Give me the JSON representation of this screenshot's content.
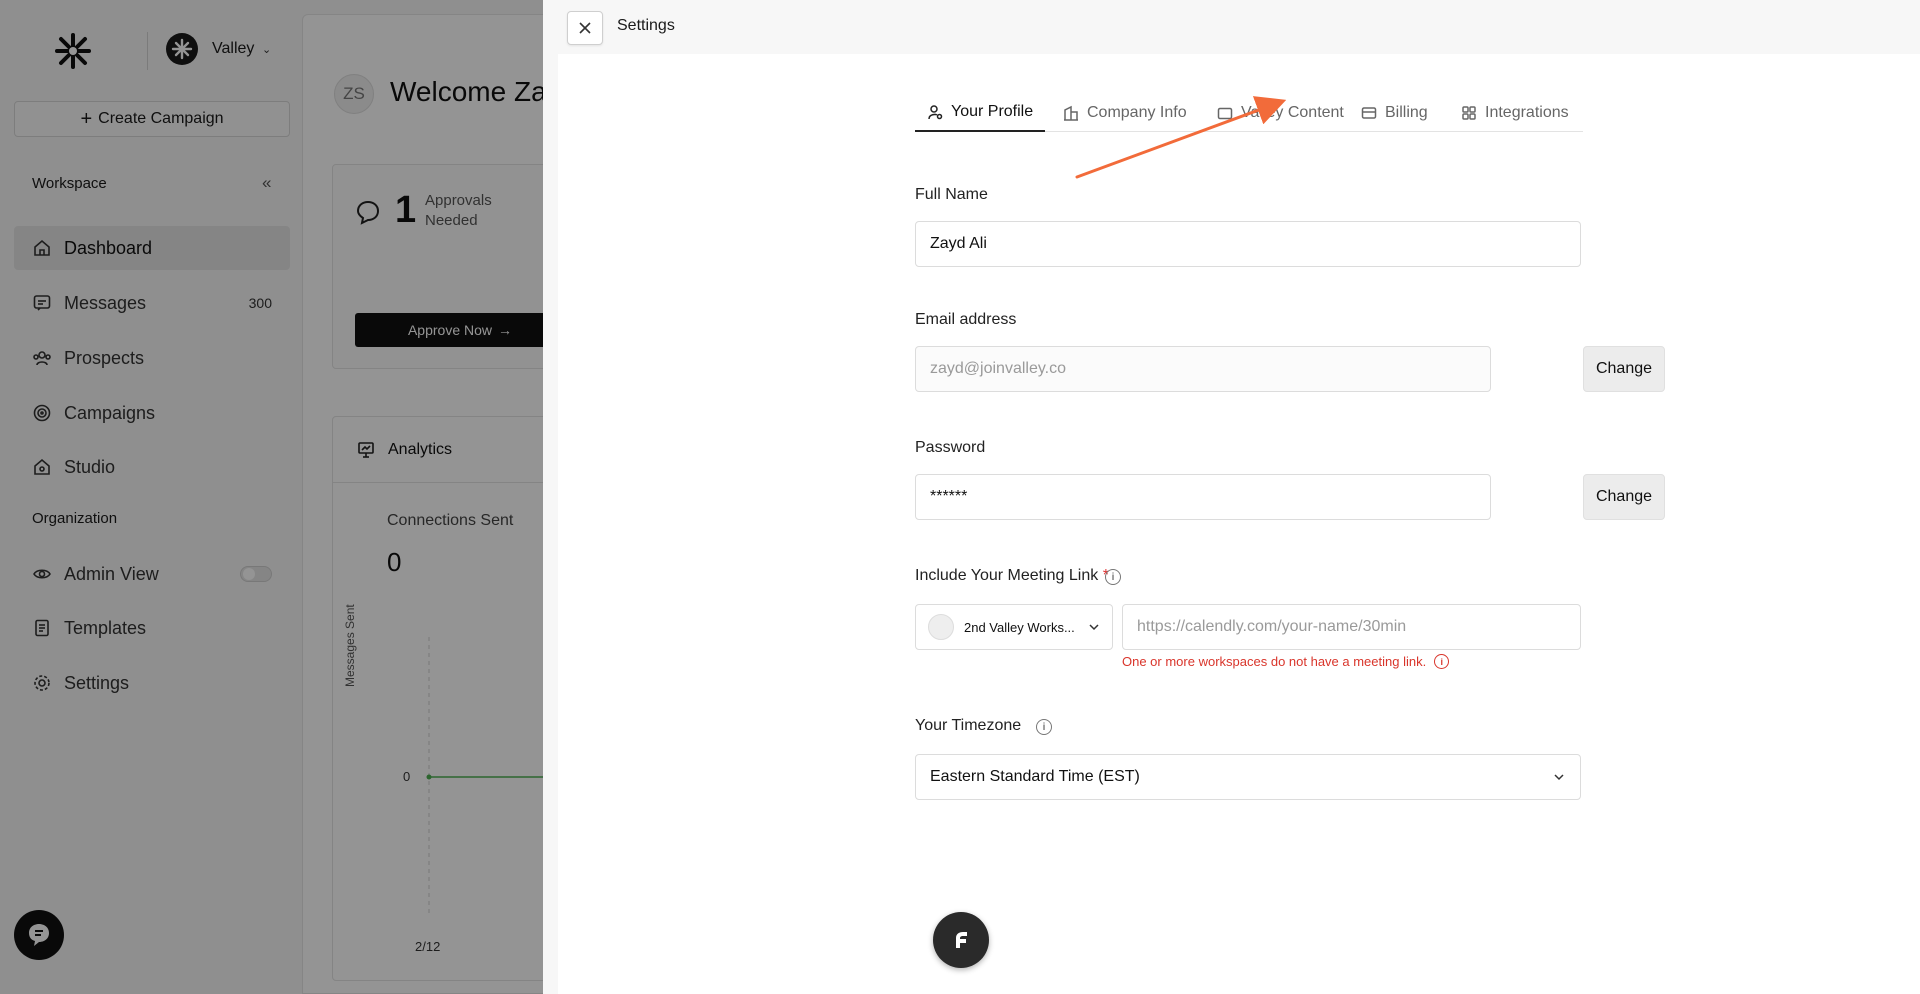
{
  "app": {
    "workspace_name": "Valley",
    "create_campaign_label": "Create Campaign",
    "workspace_section": "Workspace",
    "organization_section": "Organization",
    "nav": [
      {
        "label": "Dashboard",
        "icon": "home-icon"
      },
      {
        "label": "Messages",
        "icon": "message-icon",
        "badge": "300"
      },
      {
        "label": "Prospects",
        "icon": "people-icon"
      },
      {
        "label": "Campaigns",
        "icon": "target-icon"
      },
      {
        "label": "Studio",
        "icon": "studio-icon"
      }
    ],
    "org_nav": [
      {
        "label": "Admin View",
        "icon": "eye-icon"
      },
      {
        "label": "Templates",
        "icon": "document-icon"
      },
      {
        "label": "Settings",
        "icon": "gear-icon"
      }
    ],
    "avatar_initials": "ZS",
    "welcome_text": "Welcome Zay",
    "approvals": {
      "count": "1",
      "label": "Approvals Needed",
      "button": "Approve Now"
    },
    "analytics": {
      "title": "Analytics",
      "connections_label": "Connections Sent",
      "connections_value": "0",
      "y_axis_title": "Messages Sent",
      "y_tick": "0",
      "x_tick": "2/12"
    }
  },
  "settings": {
    "title": "Settings",
    "tabs": [
      {
        "label": "Your Profile",
        "icon": "profile-icon",
        "active": true
      },
      {
        "label": "Company Info",
        "icon": "building-icon",
        "active": false
      },
      {
        "label": "Valley Content",
        "icon": "folder-icon",
        "active": false
      },
      {
        "label": "Billing",
        "icon": "card-icon",
        "active": false
      },
      {
        "label": "Integrations",
        "icon": "grid-icon",
        "active": false
      }
    ],
    "full_name": {
      "label": "Full Name",
      "value": "Zayd Ali"
    },
    "email": {
      "label": "Email address",
      "value": "zayd@joinvalley.co",
      "change_label": "Change"
    },
    "password": {
      "label": "Password",
      "value": "******",
      "change_label": "Change"
    },
    "meeting_link": {
      "label": "Include Your Meeting Link",
      "required_mark": "*",
      "workspace_select": "2nd Valley Works...",
      "placeholder": "https://calendly.com/your-name/30min",
      "error": "One or more workspaces do not have a meeting link."
    },
    "timezone": {
      "label": "Your Timezone",
      "value": "Eastern Standard Time (EST)"
    }
  },
  "colors": {
    "accent_arrow": "#f26b3a",
    "error": "#d9352b",
    "chart_line": "#4caf50"
  }
}
